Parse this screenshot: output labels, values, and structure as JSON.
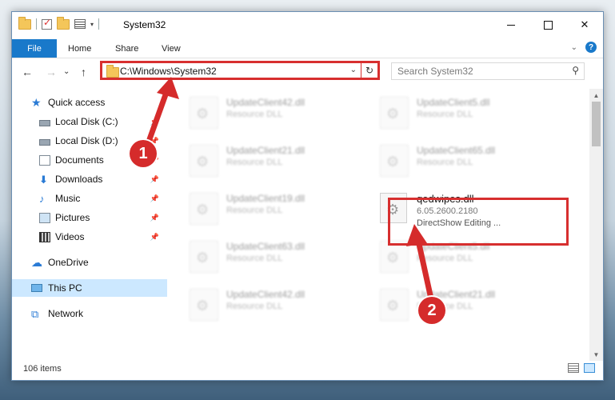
{
  "window": {
    "title": "System32",
    "caption": {
      "minimize": "",
      "maximize": "",
      "close": "✕"
    }
  },
  "ribbon": {
    "file_tab": "File",
    "tabs": [
      "Home",
      "Share",
      "View"
    ],
    "collapse_glyph": "⌄",
    "help_glyph": "?"
  },
  "address": {
    "back_glyph": "←",
    "forward_glyph": "→",
    "recent_glyph": "⌄",
    "up_glyph": "↑",
    "path": "C:\\Windows\\System32",
    "dropdown_glyph": "⌄",
    "refresh_glyph": "↻"
  },
  "search": {
    "placeholder": "Search System32",
    "icon": "search-icon",
    "glyph": "⚲"
  },
  "sidebar": {
    "items": [
      {
        "label": "Quick access",
        "icon": "star-icon"
      },
      {
        "label": "Local Disk (C:)",
        "icon": "disk-icon",
        "pinned": true
      },
      {
        "label": "Local Disk (D:)",
        "icon": "disk-icon",
        "pinned": true
      },
      {
        "label": "Documents",
        "icon": "documents-icon",
        "pinned": true
      },
      {
        "label": "Downloads",
        "icon": "downloads-icon",
        "pinned": true
      },
      {
        "label": "Music",
        "icon": "music-icon",
        "pinned": true
      },
      {
        "label": "Pictures",
        "icon": "pictures-icon",
        "pinned": true
      },
      {
        "label": "Videos",
        "icon": "videos-icon",
        "pinned": true
      },
      {
        "label": "OneDrive",
        "icon": "cloud-icon"
      },
      {
        "label": "This PC",
        "icon": "computer-icon",
        "selected": true
      },
      {
        "label": "Network",
        "icon": "network-icon"
      }
    ],
    "pin_glyph": "📌"
  },
  "files": [
    {
      "name": "UpdateClient42.dll",
      "type": "Resource DLL"
    },
    {
      "name": "UpdateClient5.dll",
      "type": "Resource DLL"
    },
    {
      "name": "UpdateClient21.dll",
      "type": "Resource DLL"
    },
    {
      "name": "UpdateClient65.dll",
      "type": "Resource DLL"
    },
    {
      "name": "UpdateClient19.dll",
      "type": "Resource DLL"
    },
    {
      "name": "UpdateClient63.dll",
      "type": "Resource DLL"
    },
    {
      "name": "UpdateClient5.dll",
      "type": "Resource DLL"
    },
    {
      "name": "UpdateClient42.dll",
      "type": "Resource DLL"
    },
    {
      "name": "UpdateClient21.dll",
      "type": "Resource DLL"
    }
  ],
  "highlighted_file": {
    "name": "qedwipes.dll",
    "version": "6.05.2600.2180",
    "description": "DirectShow Editing ..."
  },
  "scrollbar": {
    "up_glyph": "▲",
    "down_glyph": "▼"
  },
  "status": {
    "item_count": "106 items"
  },
  "annotations": {
    "step1": "1",
    "step2": "2"
  },
  "colors": {
    "accent": "#1979ca",
    "highlight": "#d72f2f",
    "selected": "#cce8ff"
  }
}
